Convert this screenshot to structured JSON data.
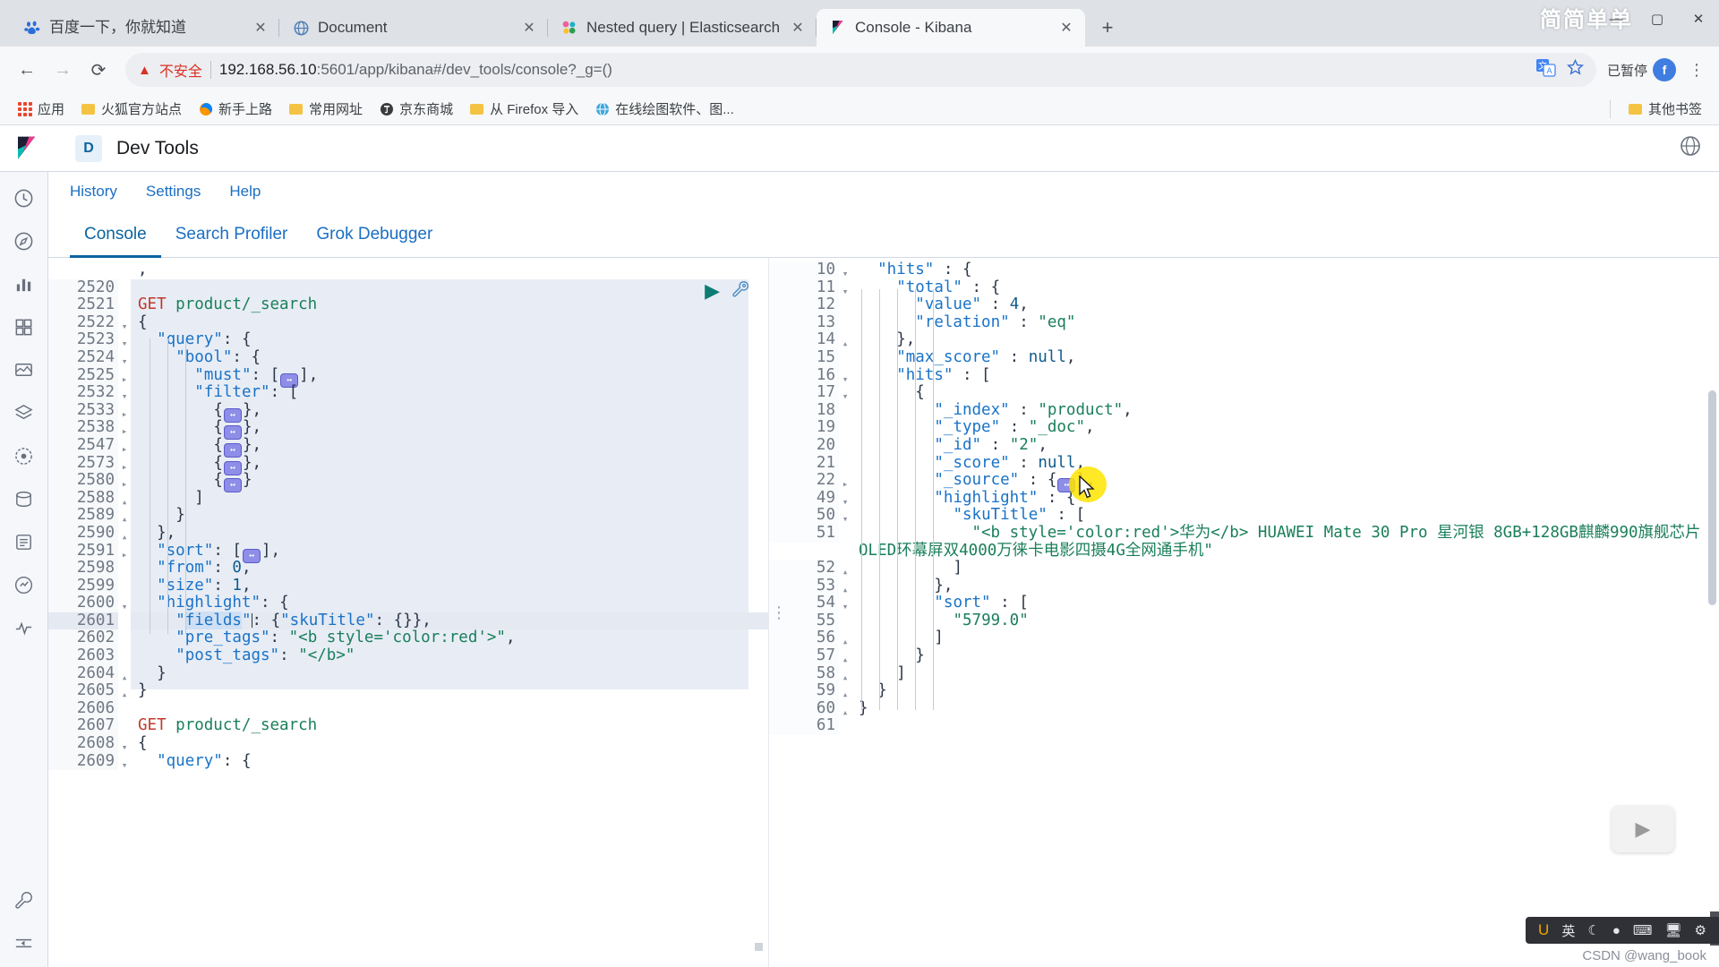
{
  "window": {
    "watermark": "简简单单",
    "controls": {
      "minimize": "—",
      "maximize": "▢",
      "close": "✕"
    }
  },
  "tabs": [
    {
      "title": "百度一下，你就知道",
      "favicon": "baidu-icon",
      "active": false,
      "close": "✕"
    },
    {
      "title": "Document",
      "favicon": "globe-icon",
      "active": false,
      "close": "✕"
    },
    {
      "title": "Nested query | Elasticsearch R",
      "favicon": "elastic-icon",
      "active": false,
      "close": "✕"
    },
    {
      "title": "Console - Kibana",
      "favicon": "kibana-icon",
      "active": true,
      "close": "✕"
    }
  ],
  "newtab_label": "+",
  "navbar": {
    "back": "←",
    "forward": "→",
    "reload": "⟳",
    "security_warning": "不安全",
    "url_host": "192.168.56.10",
    "url_rest": ":5601/app/kibana#/dev_tools/console?_g=()",
    "translate_icon": "translate-icon",
    "star_icon": "star-icon",
    "pause_label": "已暂停",
    "avatar_initial": "f",
    "menu_icon": "kebab-menu-icon"
  },
  "bookmarks": {
    "items": [
      {
        "label": "应用",
        "icon": "apps-grid-icon"
      },
      {
        "label": "火狐官方站点",
        "icon": "folder-icon"
      },
      {
        "label": "新手上路",
        "icon": "firefox-icon"
      },
      {
        "label": "常用网址",
        "icon": "folder-icon"
      },
      {
        "label": "京东商城",
        "icon": "jd-icon"
      },
      {
        "label": "从 Firefox 导入",
        "icon": "folder-icon"
      },
      {
        "label": "在线绘图软件、图...",
        "icon": "globe-icon"
      }
    ],
    "other": {
      "label": "其他书签",
      "icon": "folder-icon"
    }
  },
  "kibana": {
    "logo": "kibana-logo-icon",
    "space_badge": "D",
    "app_title": "Dev Tools",
    "help_icon": "help-circle-icon",
    "toolbar": [
      {
        "label": "History"
      },
      {
        "label": "Settings"
      },
      {
        "label": "Help"
      }
    ],
    "tabs": [
      {
        "label": "Console",
        "active": true
      },
      {
        "label": "Search Profiler",
        "active": false
      },
      {
        "label": "Grok Debugger",
        "active": false
      }
    ],
    "rail_icons": [
      "recent-clock-icon",
      "discover-compass-icon",
      "visualize-chart-icon",
      "dashboard-icon",
      "canvas-icon",
      "maps-layers-icon",
      "ml-icon",
      "infrastructure-icon",
      "logs-icon",
      "apm-icon",
      "uptime-icon",
      "devtools-wrench-icon",
      "collapse-arrow-icon"
    ],
    "run_button": "▶",
    "wrench_button": "🔧"
  },
  "request_editor": {
    "lines": [
      {
        "n": "",
        "fold": "",
        "code": ","
      },
      {
        "n": "2520",
        "fold": "",
        "code": ""
      },
      {
        "n": "2521",
        "fold": "",
        "code": "GET product/_search",
        "type": "request"
      },
      {
        "n": "2522",
        "fold": "▾",
        "code": "{"
      },
      {
        "n": "2523",
        "fold": "▾",
        "code": "  \"query\": {"
      },
      {
        "n": "2524",
        "fold": "▾",
        "code": "    \"bool\": {"
      },
      {
        "n": "2525",
        "fold": "▸",
        "code": "      \"must\": [⟺],"
      },
      {
        "n": "2532",
        "fold": "▾",
        "code": "      \"filter\": ["
      },
      {
        "n": "2533",
        "fold": "▸",
        "code": "        {⟺},"
      },
      {
        "n": "2538",
        "fold": "▸",
        "code": "        {⟺},"
      },
      {
        "n": "2547",
        "fold": "▸",
        "code": "        {⟺},"
      },
      {
        "n": "2573",
        "fold": "▸",
        "code": "        {⟺},"
      },
      {
        "n": "2580",
        "fold": "▸",
        "code": "        {⟺}"
      },
      {
        "n": "2588",
        "fold": "▴",
        "code": "      ]"
      },
      {
        "n": "2589",
        "fold": "▴",
        "code": "    }"
      },
      {
        "n": "2590",
        "fold": "▴",
        "code": "  },"
      },
      {
        "n": "2591",
        "fold": "▸",
        "code": "  \"sort\": [⟺],"
      },
      {
        "n": "2598",
        "fold": "",
        "code": "  \"from\": 0,"
      },
      {
        "n": "2599",
        "fold": "",
        "code": "  \"size\": 1,"
      },
      {
        "n": "2600",
        "fold": "▾",
        "code": "  \"highlight\": {"
      },
      {
        "n": "2601",
        "fold": "",
        "code": "    \"fields\": {\"skuTitle\": {}},",
        "current": true
      },
      {
        "n": "2602",
        "fold": "",
        "code": "    \"pre_tags\": \"<b style='color:red'>\","
      },
      {
        "n": "2603",
        "fold": "",
        "code": "    \"post_tags\": \"</b>\""
      },
      {
        "n": "2604",
        "fold": "▴",
        "code": "  }"
      },
      {
        "n": "2605",
        "fold": "▴",
        "code": "}"
      },
      {
        "n": "2606",
        "fold": "",
        "code": ""
      },
      {
        "n": "2607",
        "fold": "",
        "code": "GET product/_search",
        "type": "request"
      },
      {
        "n": "2608",
        "fold": "▾",
        "code": "{"
      },
      {
        "n": "2609",
        "fold": "▾",
        "code": "  \"query\": {"
      }
    ]
  },
  "response_editor": {
    "lines": [
      {
        "n": "10",
        "fold": "▾",
        "code": "  \"hits\" : {"
      },
      {
        "n": "11",
        "fold": "▾",
        "code": "    \"total\" : {"
      },
      {
        "n": "12",
        "fold": "",
        "code": "      \"value\" : 4,"
      },
      {
        "n": "13",
        "fold": "",
        "code": "      \"relation\" : \"eq\""
      },
      {
        "n": "14",
        "fold": "▴",
        "code": "    },"
      },
      {
        "n": "15",
        "fold": "",
        "code": "    \"max_score\" : null,"
      },
      {
        "n": "16",
        "fold": "▾",
        "code": "    \"hits\" : ["
      },
      {
        "n": "17",
        "fold": "▾",
        "code": "      {"
      },
      {
        "n": "18",
        "fold": "",
        "code": "        \"_index\" : \"product\","
      },
      {
        "n": "19",
        "fold": "",
        "code": "        \"_type\" : \"_doc\","
      },
      {
        "n": "20",
        "fold": "",
        "code": "        \"_id\" : \"2\","
      },
      {
        "n": "21",
        "fold": "",
        "code": "        \"_score\" : null,"
      },
      {
        "n": "22",
        "fold": "▸",
        "code": "        \"_source\" : {⟺},"
      },
      {
        "n": "49",
        "fold": "▾",
        "code": "        \"highlight\" : {"
      },
      {
        "n": "50",
        "fold": "▾",
        "code": "          \"skuTitle\" : ["
      },
      {
        "n": "51",
        "fold": "",
        "code": "            \"<b style='color:red'>华为</b> HUAWEI Mate 30 Pro 星河银 8GB+128GB麒麟990旗舰芯片OLED环幕屏双4000万徕卡电影四摄4G全网通手机\"",
        "wrap": true
      },
      {
        "n": "52",
        "fold": "▴",
        "code": "          ]"
      },
      {
        "n": "53",
        "fold": "▴",
        "code": "        },"
      },
      {
        "n": "54",
        "fold": "▾",
        "code": "        \"sort\" : ["
      },
      {
        "n": "55",
        "fold": "",
        "code": "          \"5799.0\""
      },
      {
        "n": "56",
        "fold": "▴",
        "code": "        ]"
      },
      {
        "n": "57",
        "fold": "▴",
        "code": "      }"
      },
      {
        "n": "58",
        "fold": "▴",
        "code": "    ]"
      },
      {
        "n": "59",
        "fold": "▴",
        "code": "  }"
      },
      {
        "n": "60",
        "fold": "▴",
        "code": "}"
      },
      {
        "n": "61",
        "fold": "",
        "code": ""
      }
    ]
  },
  "overlay": {
    "ime": {
      "logo": "U",
      "mode": "英",
      "moon": "☾",
      "dot": "●",
      "keyboard": "⌨",
      "screen": "🖥",
      "settings": "⚙"
    },
    "watermark_credit": "CSDN @wang_book",
    "float_play": "▶"
  }
}
